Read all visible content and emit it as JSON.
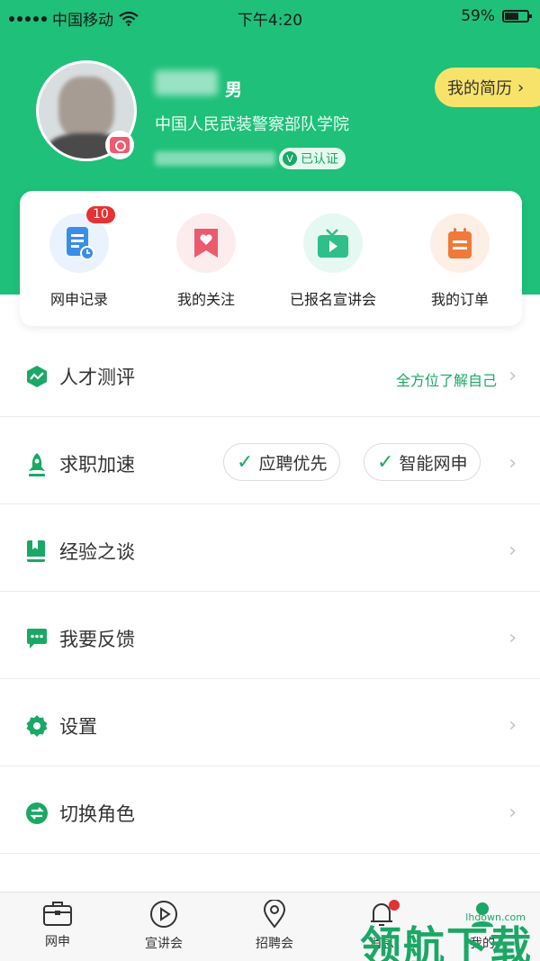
{
  "status_bar": {
    "carrier": "中国移动",
    "time": "下午4:20",
    "battery": "59%"
  },
  "profile": {
    "gender": "男",
    "school": "中国人民武装警察部队学院",
    "verified_label": "已认证",
    "verified_badge": "V",
    "resume_button": "我的简历"
  },
  "quick_actions": [
    {
      "label": "网申记录",
      "badge": "10",
      "color": "#3a8ee6"
    },
    {
      "label": "我的关注",
      "color": "#ec5a6e"
    },
    {
      "label": "已报名宣讲会",
      "color": "#2fbf8a"
    },
    {
      "label": "我的订单",
      "color": "#f07a3a"
    }
  ],
  "menu": {
    "talent": {
      "label": "人才测评",
      "hint": "全方位了解自己"
    },
    "job_speed": {
      "label": "求职加速",
      "pill1": "应聘优先",
      "pill2": "智能网申"
    },
    "experience": {
      "label": "经验之谈"
    },
    "feedback": {
      "label": "我要反馈"
    },
    "settings": {
      "label": "设置"
    },
    "switch_role": {
      "label": "切换角色"
    }
  },
  "tabbar": {
    "tab1": "网申",
    "tab2": "宣讲会",
    "tab3": "招聘会",
    "tab4": "消息",
    "tab5": "我的"
  },
  "watermark": {
    "text": "领航下载",
    "site": "lhdown.com"
  },
  "accent_color": "#1ec07a"
}
